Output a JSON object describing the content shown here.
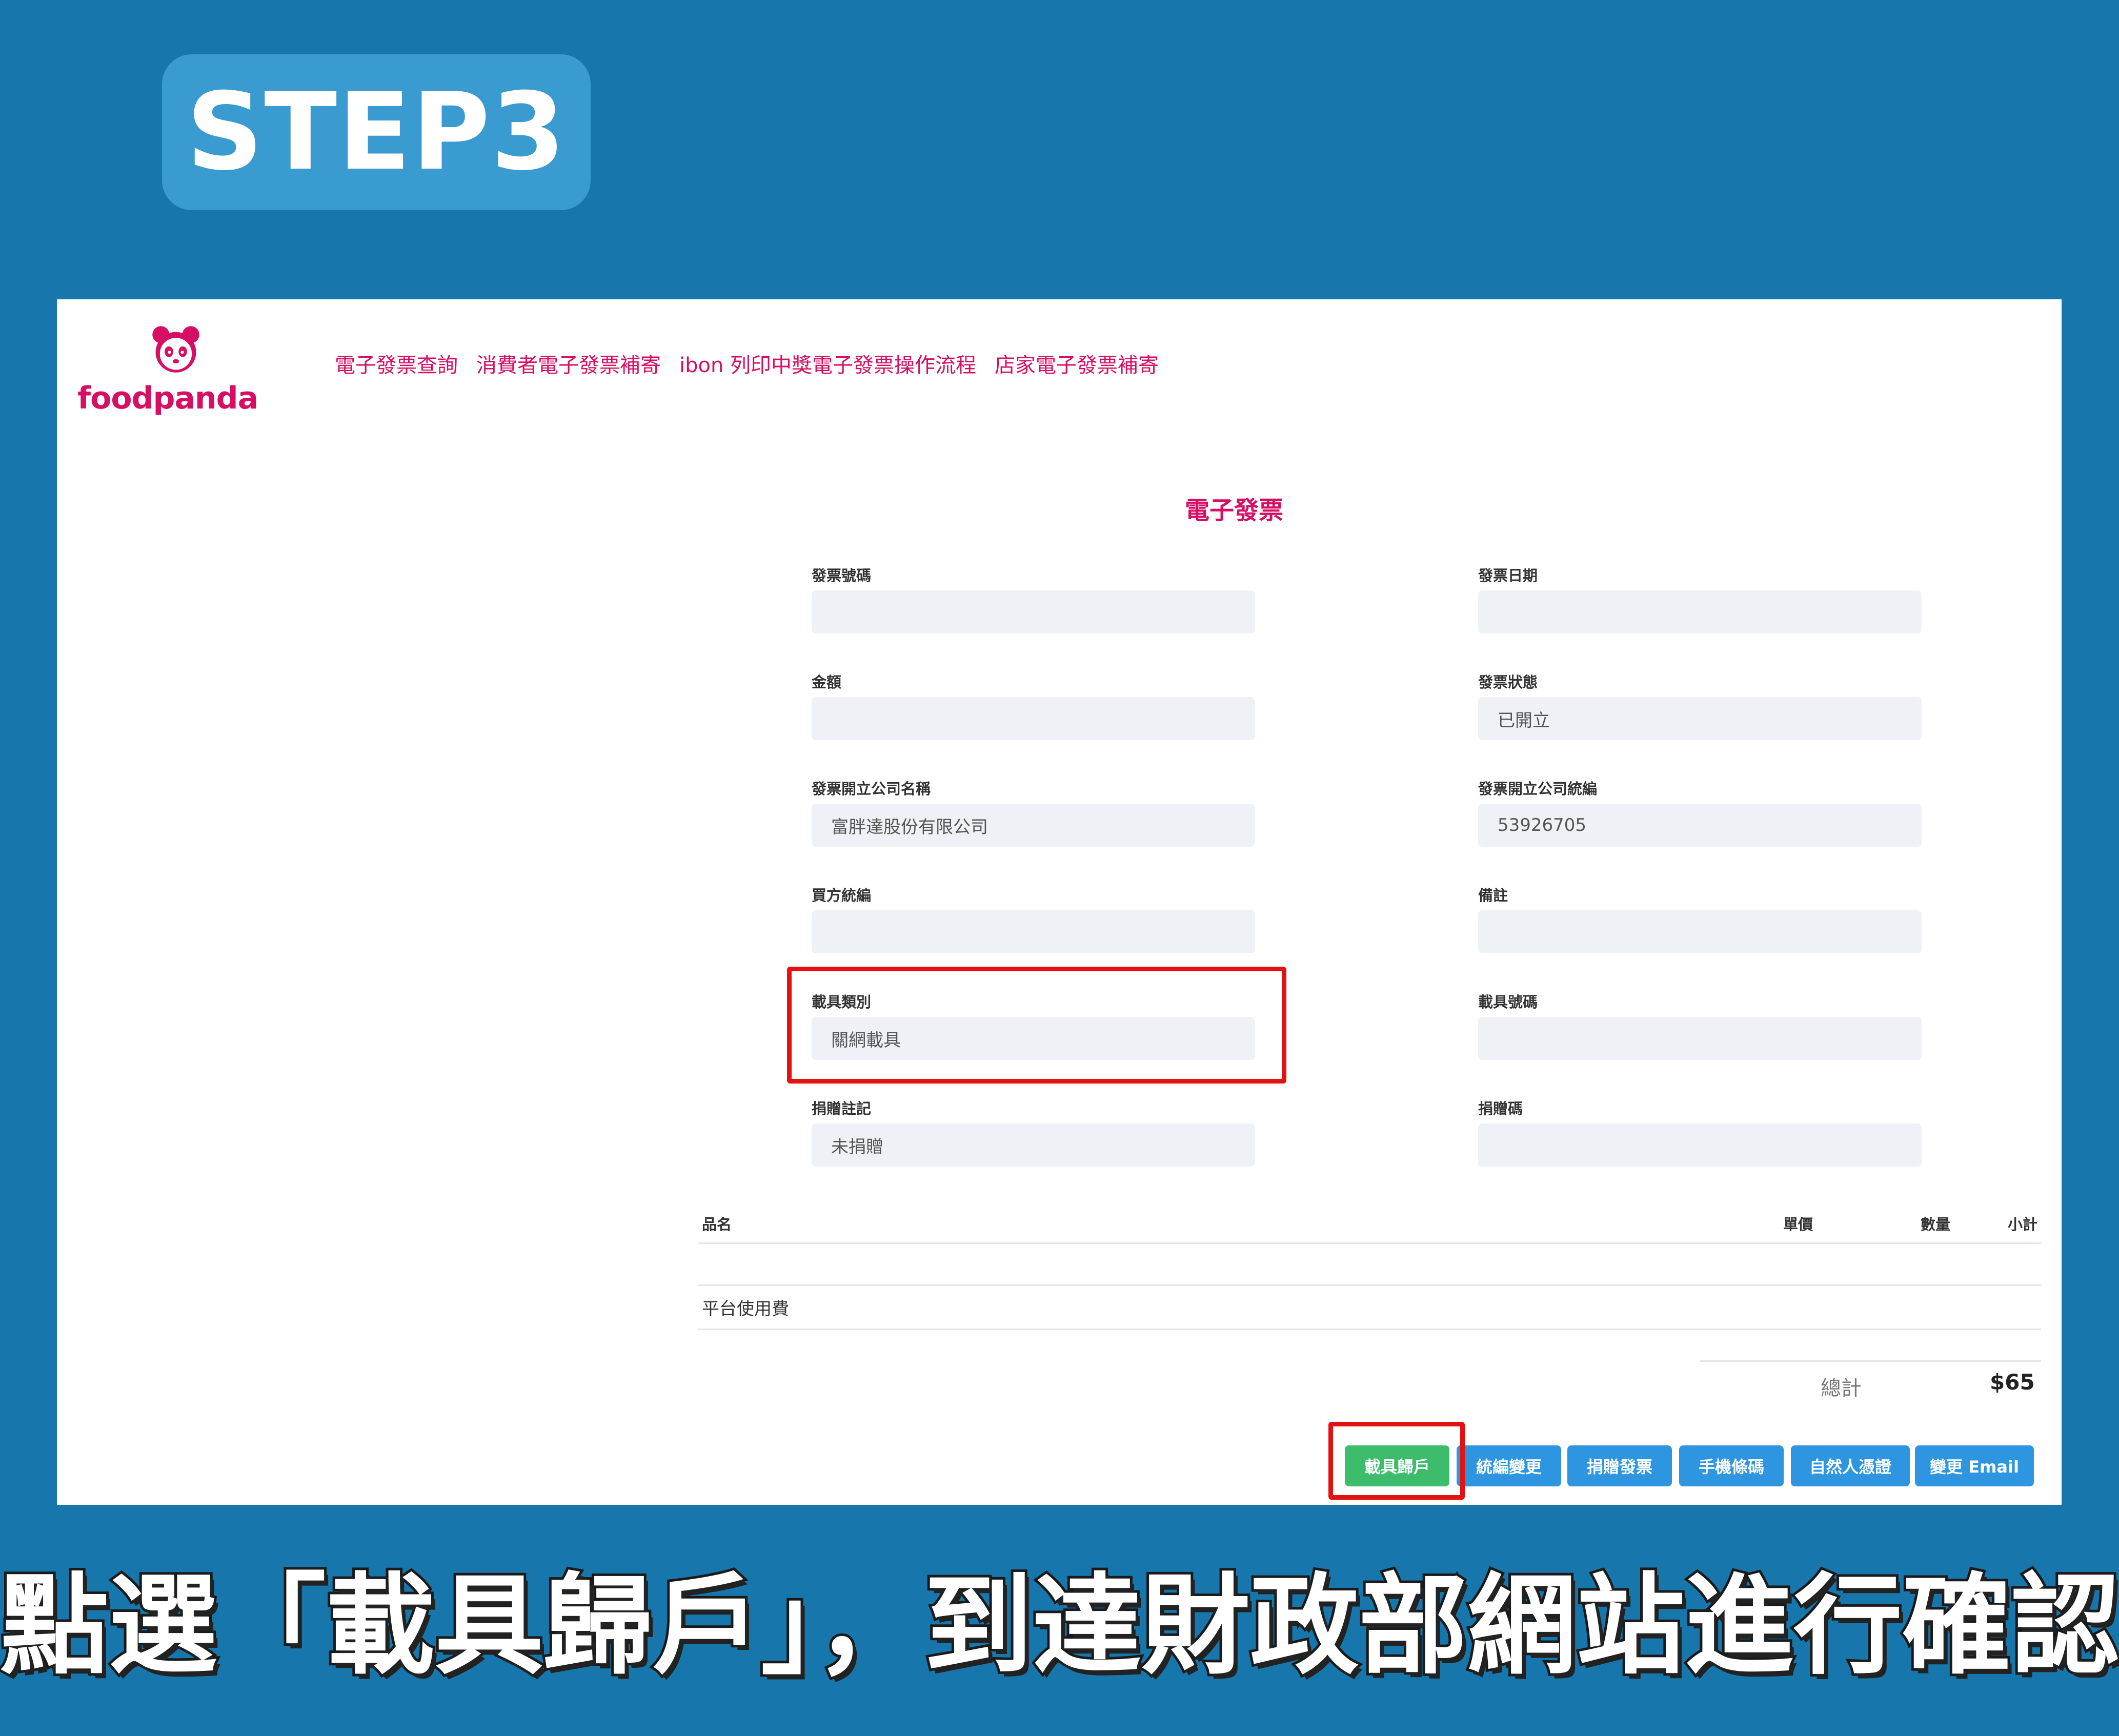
{
  "step_badge": "STEP3",
  "logo_text": "foodpanda",
  "nav": [
    "電子發票查詢",
    "消費者電子發票補寄",
    "ibon 列印中獎電子發票操作流程",
    "店家電子發票補寄"
  ],
  "form": {
    "title": "電子發票",
    "fields": {
      "invoice_no": {
        "label": "發票號碼",
        "value": ""
      },
      "invoice_date": {
        "label": "發票日期",
        "value": ""
      },
      "amount": {
        "label": "金額",
        "value": ""
      },
      "status": {
        "label": "發票狀態",
        "value": "已開立"
      },
      "company_name": {
        "label": "發票開立公司名稱",
        "value": "富胖達股份有限公司"
      },
      "company_tax_id": {
        "label": "發票開立公司統編",
        "value": "53926705"
      },
      "buyer_tax_id": {
        "label": "買方統編",
        "value": ""
      },
      "remark": {
        "label": "備註",
        "value": ""
      },
      "carrier_type": {
        "label": "載具類別",
        "value": "關網載具"
      },
      "carrier_no": {
        "label": "載具號碼",
        "value": ""
      },
      "donation_mark": {
        "label": "捐贈註記",
        "value": "未捐贈"
      },
      "donation_code": {
        "label": "捐贈碼",
        "value": ""
      }
    }
  },
  "table": {
    "headers": {
      "name": "品名",
      "unit_price": "單價",
      "qty": "數量",
      "subtotal": "小計"
    },
    "rows": [
      {
        "name": "平台使用費"
      }
    ],
    "total_label": "總計",
    "total_value": "$65"
  },
  "buttons": {
    "carrier_link": "載具歸戶",
    "tax_id_change": "統編變更",
    "donate": "捐贈發票",
    "mobile_barcode": "手機條碼",
    "citizen_cert": "自然人憑證",
    "change_email": "變更 Email"
  },
  "caption": "點選「載具歸戶」，到達財政部網站進行確認",
  "colors": {
    "background": "#1777ac",
    "badge": "#3a9bd1",
    "brand": "#d70f64",
    "highlight": "#e31212",
    "green_button": "#3dbc6b",
    "blue_button": "#2e95e0"
  }
}
